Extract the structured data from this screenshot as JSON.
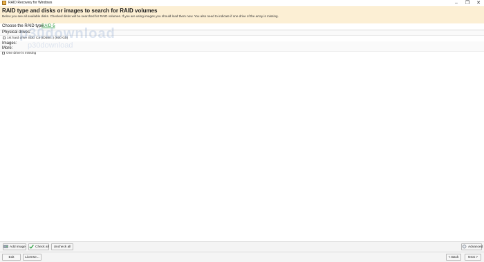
{
  "window": {
    "title": "RAID Recovery for Windows",
    "minimize_glyph": "–",
    "maximize_glyph": "❐",
    "close_glyph": "✕"
  },
  "header": {
    "title": "RAID type and disks or images to search for RAID volumes",
    "description": "Below you see all available disks. Checked disks will be searched for RAID volumes. If you are using images you should load them now. You also need to indicate if one drive of the array is missing."
  },
  "raid": {
    "label": "Choose the RAID type:",
    "value": "RAID-5"
  },
  "sections": {
    "physical_drives": "Physical drives:",
    "images": "Images:",
    "more": "More:"
  },
  "drives": [
    {
      "label": "1st hard drive SDD Ca (ID580..) (600 Gb)",
      "checked": false
    }
  ],
  "more": {
    "one_drive_missing": "One drive is missing",
    "checked": false
  },
  "toolbar": {
    "add_image": "Add image",
    "check_all": "Check all",
    "uncheck_all": "Uncheck all",
    "advanced": "Advanced"
  },
  "footer": {
    "exit": "Exit",
    "license": "License...",
    "back": "< Back",
    "next": "Next >"
  },
  "colors": {
    "header_bg": "#fcefd4",
    "link_green": "#2a9a3c"
  },
  "icons": {
    "add_image": "disk-add-icon",
    "check_all": "checkmark-icon",
    "advanced": "gear-icon"
  }
}
